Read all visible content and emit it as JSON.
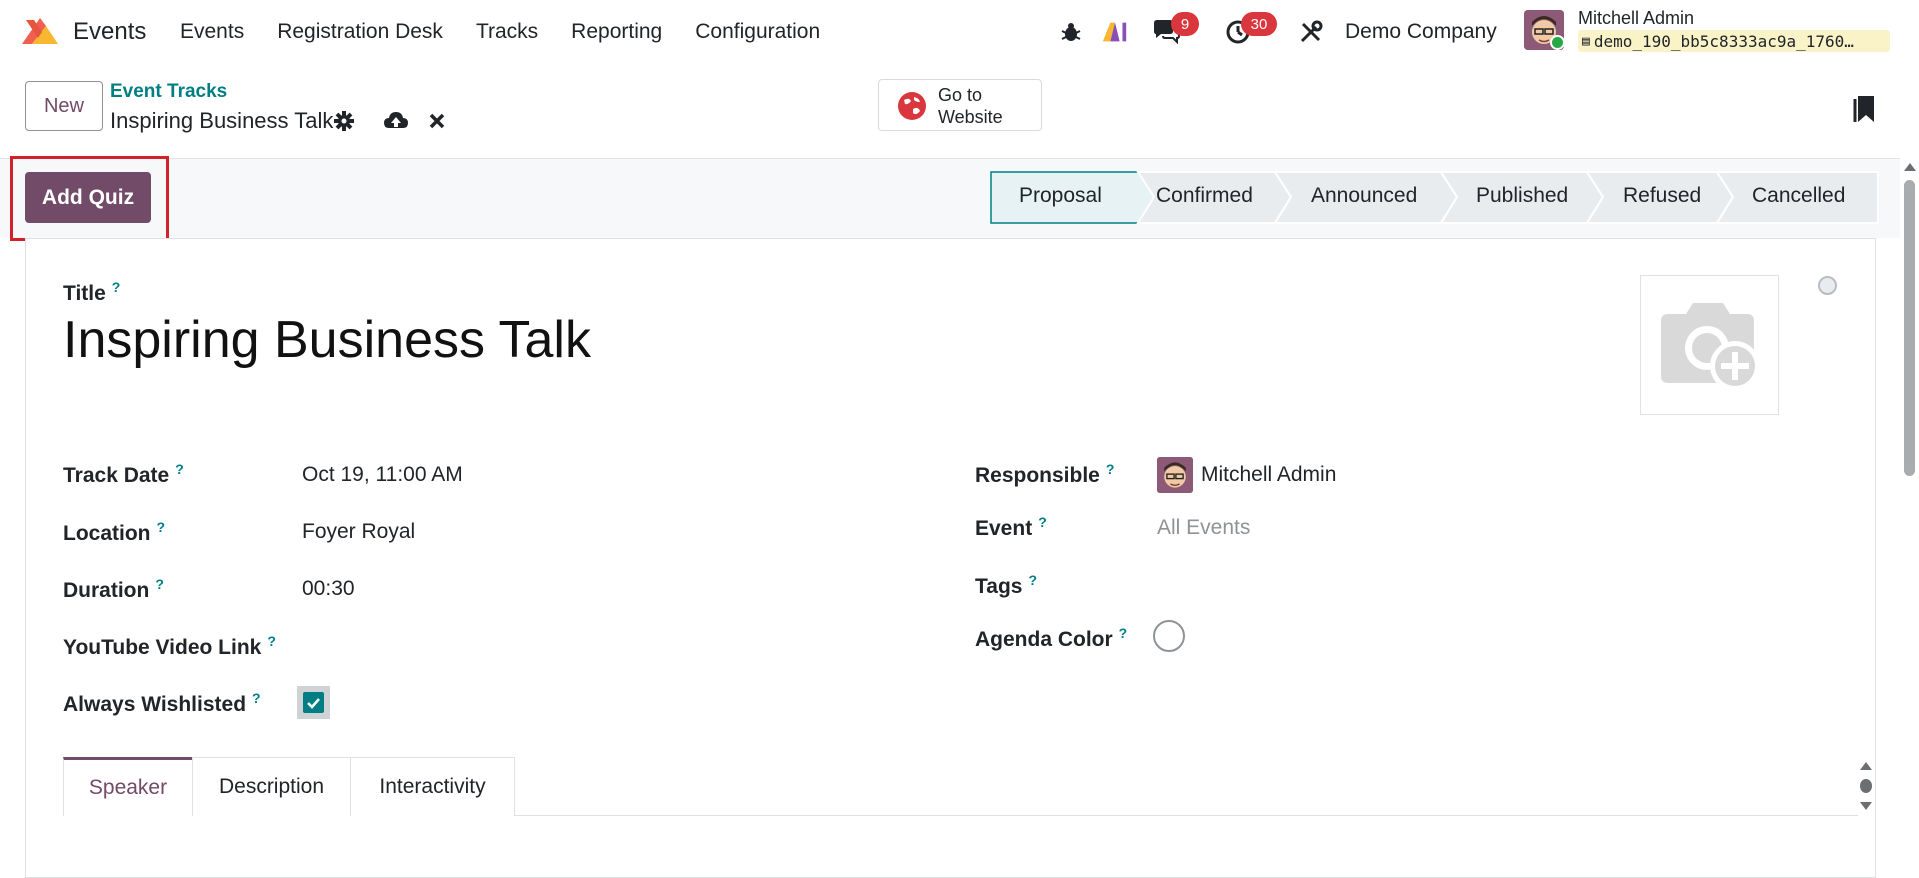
{
  "navbar": {
    "app_name": "Events",
    "menu": [
      "Events",
      "Registration Desk",
      "Tracks",
      "Reporting",
      "Configuration"
    ],
    "messages_count": "9",
    "activities_count": "30",
    "company": "Demo Company",
    "user_name": "Mitchell Admin",
    "database": "demo_190_bb5c8333ac9a_1760…",
    "icons": [
      "bug-icon",
      "ai-icon",
      "chat-icon",
      "clock-icon",
      "tools-icon"
    ]
  },
  "control_panel": {
    "new_label": "New",
    "breadcrumb": "Event Tracks",
    "record_name": "Inspiring Business Talk",
    "website_label_1": "Go to",
    "website_label_2": "Website"
  },
  "statusbar": {
    "button_label": "Add Quiz",
    "stages": [
      "Proposal",
      "Confirmed",
      "Announced",
      "Published",
      "Refused",
      "Cancelled"
    ],
    "active_stage": "Proposal"
  },
  "form": {
    "title_label": "Title",
    "title_value": "Inspiring Business Talk",
    "help_mark": "?",
    "left": {
      "track_date_label": "Track Date",
      "track_date_value": "Oct 19, 11:00 AM",
      "location_label": "Location",
      "location_value": "Foyer Royal",
      "duration_label": "Duration",
      "duration_value": "00:30",
      "youtube_label": "YouTube Video Link",
      "wishlisted_label": "Always Wishlisted",
      "wishlisted_checked": true
    },
    "right": {
      "responsible_label": "Responsible",
      "responsible_value": "Mitchell Admin",
      "event_label": "Event",
      "event_value": "All Events",
      "tags_label": "Tags",
      "agenda_color_label": "Agenda Color"
    },
    "tabs": [
      "Speaker",
      "Description",
      "Interactivity"
    ],
    "active_tab": "Speaker"
  },
  "colors": {
    "brand": "#714b67",
    "link": "#017e84",
    "badge": "#d9363e",
    "highlight": "#d32128"
  }
}
